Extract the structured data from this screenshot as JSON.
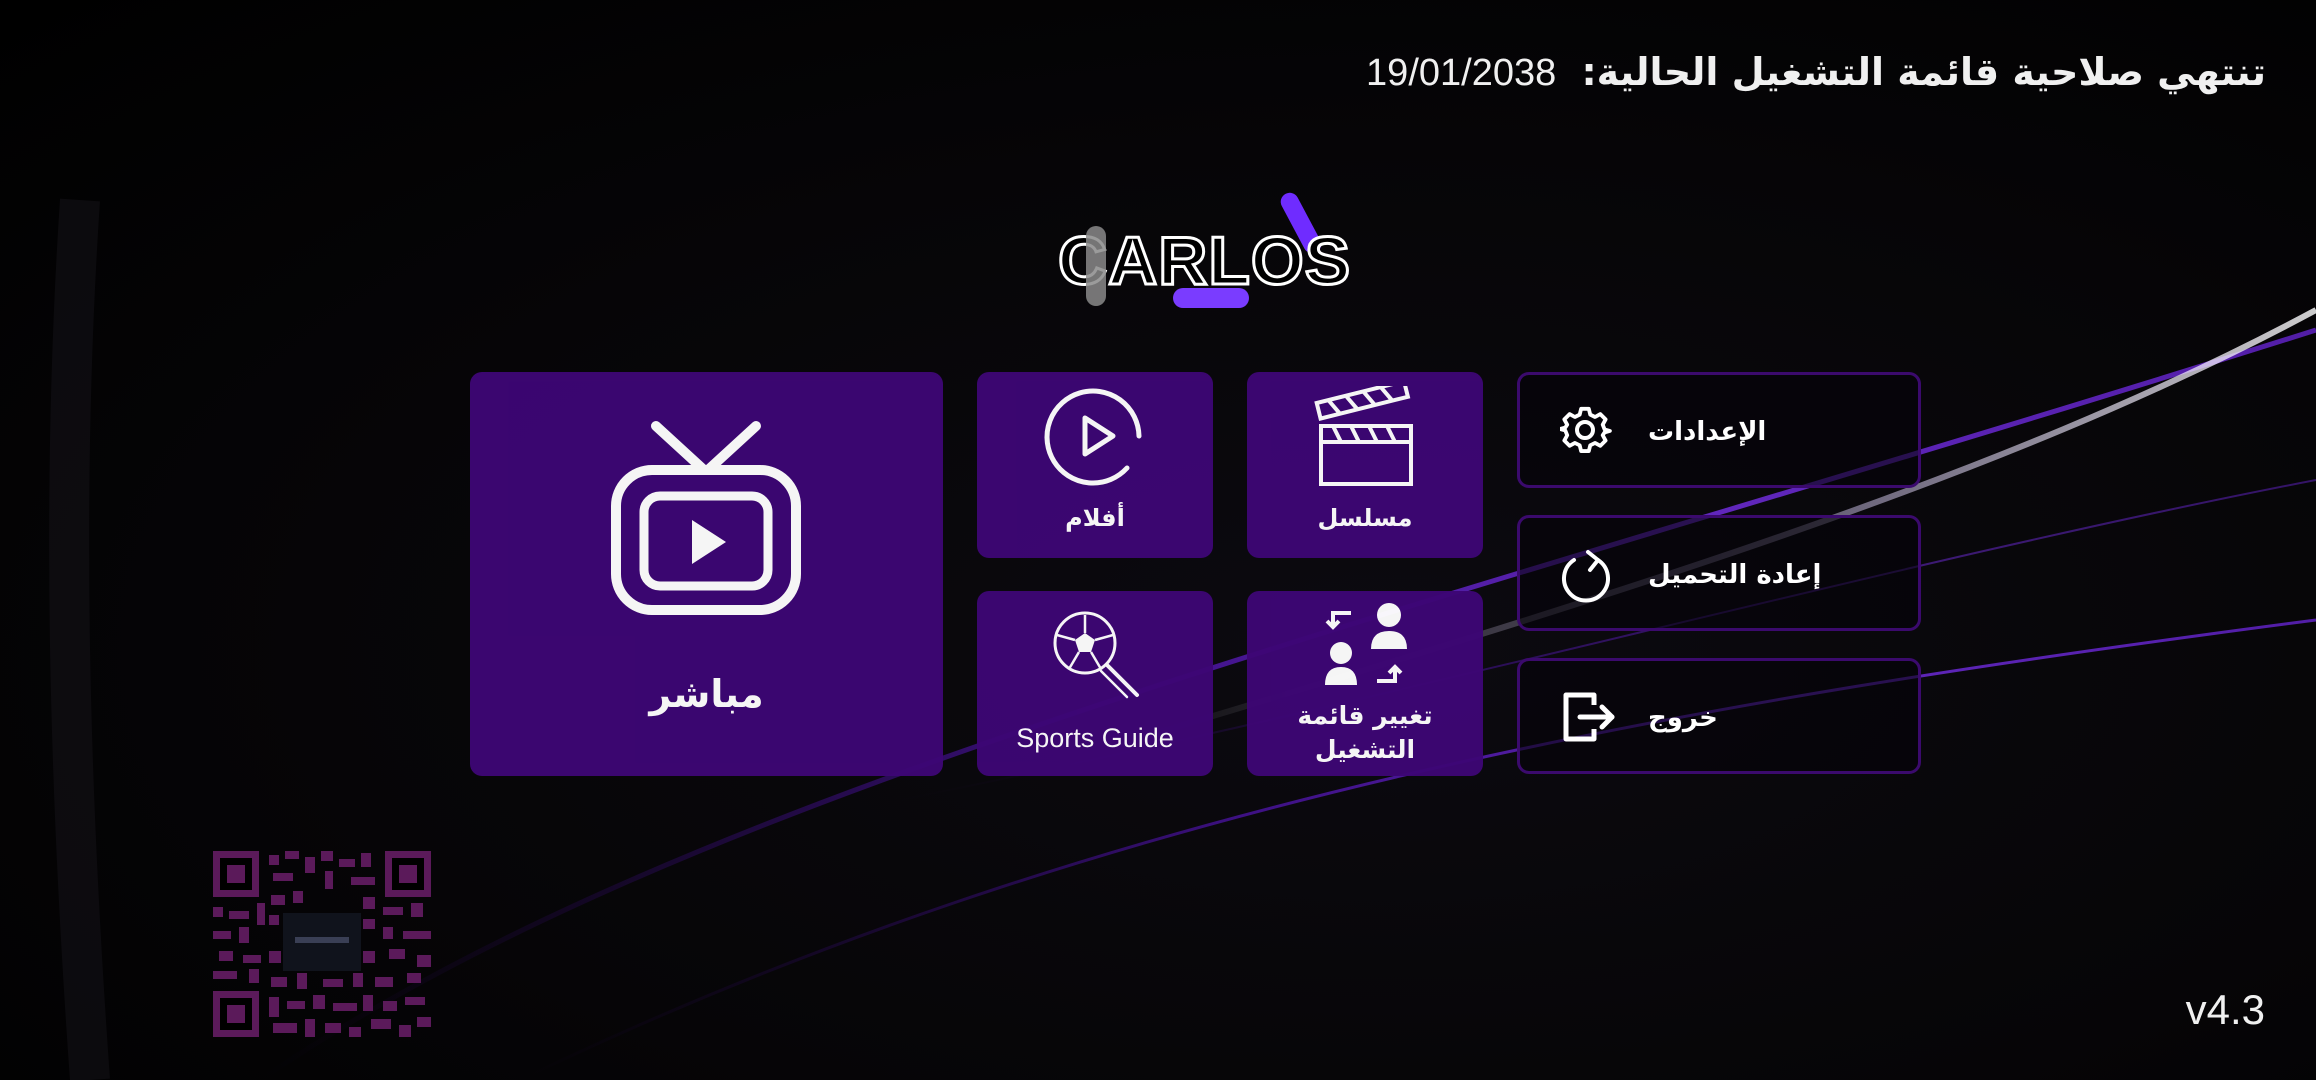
{
  "header": {
    "expiry_label": "تنتهي صلاحية قائمة التشغيل الحالية:",
    "expiry_date": "19/01/2038"
  },
  "logo": {
    "text": "CARLOS",
    "accent_color": "#7a3cff"
  },
  "tiles": {
    "live": {
      "label": "مباشر",
      "icon": "tv-play-icon"
    },
    "movies": {
      "label": "أفلام",
      "icon": "play-circle-icon"
    },
    "series": {
      "label": "مسلسل",
      "icon": "clapperboard-icon"
    },
    "sports": {
      "label": "Sports Guide",
      "icon": "soccer-ball-search-icon"
    },
    "change_playlist": {
      "label_line1": "تغيير قائمة",
      "label_line2": "التشغيل",
      "icon": "swap-users-icon"
    }
  },
  "side_buttons": {
    "settings": {
      "label": "الإعدادات",
      "icon": "gear-icon"
    },
    "reload": {
      "label": "إعادة التحميل",
      "icon": "refresh-icon"
    },
    "exit": {
      "label": "خروج",
      "icon": "exit-icon"
    }
  },
  "footer": {
    "version": "v4.3"
  },
  "colors": {
    "tile_bg": "#3d0675",
    "button_border": "#3b0a6d",
    "background": "#000000"
  }
}
